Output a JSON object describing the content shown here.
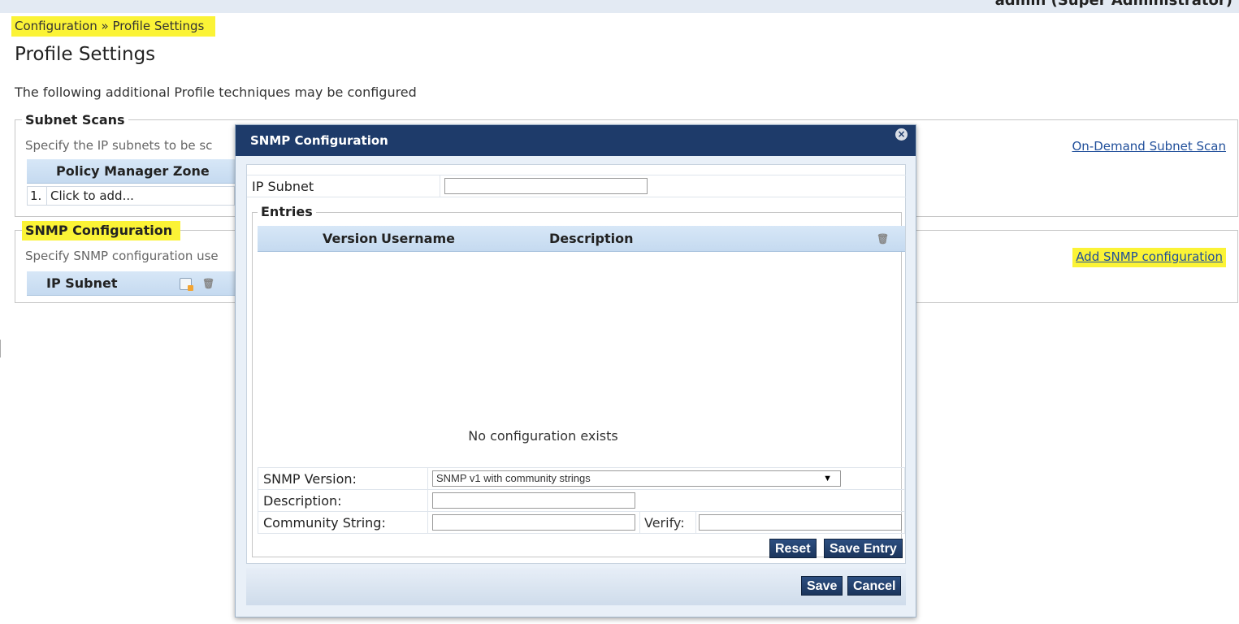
{
  "header": {
    "user": "admin (Super Administrator)"
  },
  "breadcrumb": "Configuration » Profile Settings",
  "page_title": "Profile Settings",
  "intro": "The following additional Profile techniques may be configured",
  "subnet_scans": {
    "legend": "Subnet Scans",
    "description": "Specify the IP subnets to be sc",
    "column_header": "Policy Manager Zone",
    "row_num": "1.",
    "row_text": "Click to add...",
    "link": "On-Demand Subnet Scan"
  },
  "snmp_section": {
    "legend": "SNMP Configuration",
    "description": "Specify SNMP configuration use",
    "column_header": "IP Subnet",
    "link": "Add SNMP configuration"
  },
  "modal": {
    "title": "SNMP Configuration",
    "close_glyph": "×",
    "ip_subnet_label": "IP Subnet",
    "ip_subnet_value": "",
    "entries_legend": "Entries",
    "columns": [
      "Version",
      "Username",
      "Description"
    ],
    "empty_message": "No configuration exists",
    "snmp_version_label": "SNMP Version:",
    "snmp_version_value": "SNMP v1 with community strings",
    "description_label": "Description:",
    "description_value": "",
    "community_label": "Community String:",
    "community_value": "",
    "verify_label": "Verify:",
    "verify_value": "",
    "reset_button": "Reset",
    "save_entry_button": "Save Entry",
    "save_button": "Save",
    "cancel_button": "Cancel"
  },
  "icons": {
    "trash": "trash-icon",
    "edit": "edit-icon",
    "close": "close-icon",
    "dropdown": "chevron-down-icon"
  },
  "colors": {
    "highlight": "#fbf336",
    "modal_header": "#1e3b6a",
    "link": "#1f4e9a",
    "button": "#1b355c"
  }
}
